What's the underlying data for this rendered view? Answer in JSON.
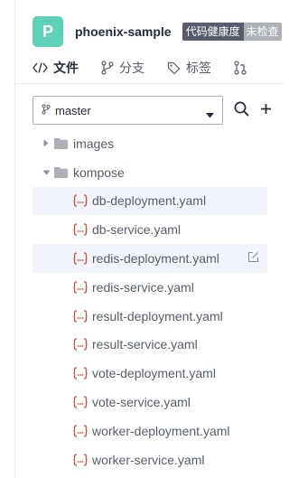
{
  "header": {
    "avatar_letter": "P",
    "repo_name": "phoenix-sample",
    "badge_left": "代码健康度",
    "badge_right": "未检查"
  },
  "tabs": [
    {
      "label": "文件",
      "icon": "code-icon",
      "active": true
    },
    {
      "label": "分支",
      "icon": "branch-icon",
      "active": false
    },
    {
      "label": "标签",
      "icon": "tag-icon",
      "active": false
    },
    {
      "label": "",
      "icon": "merge-request-icon",
      "active": false
    }
  ],
  "branch": {
    "selected": "master"
  },
  "tree": {
    "folders": [
      {
        "name": "images",
        "expanded": false
      },
      {
        "name": "kompose",
        "expanded": true
      }
    ],
    "files": [
      "db-deployment.yaml",
      "db-service.yaml",
      "redis-deployment.yaml",
      "redis-service.yaml",
      "result-deployment.yaml",
      "result-service.yaml",
      "vote-deployment.yaml",
      "vote-service.yaml",
      "worker-deployment.yaml",
      "worker-service.yaml"
    ]
  },
  "colors": {
    "avatar": "#5fd1b8",
    "yaml_icon": "#e0483e",
    "highlight_row": "#f2f5fc",
    "badge_left_bg": "#575d6c",
    "badge_right_bg": "#adb0b8"
  }
}
